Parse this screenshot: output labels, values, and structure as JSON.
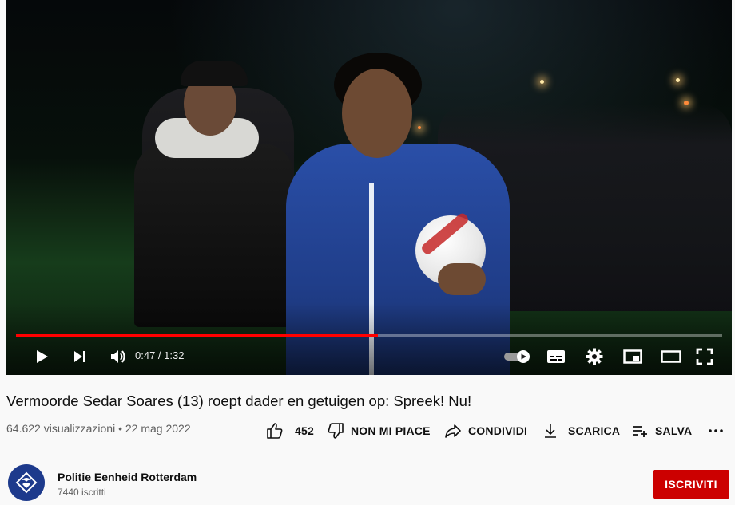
{
  "player": {
    "time_display": "0:47 / 1:32",
    "progress_fraction": 0.512,
    "accent": "#ff0000",
    "controls": [
      "play-icon",
      "next-icon",
      "volume-icon",
      "autoplay-toggle-icon",
      "subtitles-icon",
      "settings-icon",
      "miniplayer-icon",
      "theater-mode-icon",
      "fullscreen-icon"
    ]
  },
  "video": {
    "title": "Vermoorde Sedar Soares (13) roept dader en getuigen op: Spreek! Nu!",
    "views": "64.622 visualizzazioni",
    "separator": "•",
    "date": "22 mag 2022"
  },
  "actions": {
    "like_count": "452",
    "dislike_label": "NON MI PIACE",
    "share_label": "CONDIVIDI",
    "download_label": "SCARICA",
    "save_label": "SALVA",
    "more_label": "..."
  },
  "channel": {
    "name": "Politie Eenheid Rotterdam",
    "subscribers": "7440 iscritti",
    "subscribe_label": "ISCRIVITI",
    "subscribe_color": "#cc0000"
  }
}
